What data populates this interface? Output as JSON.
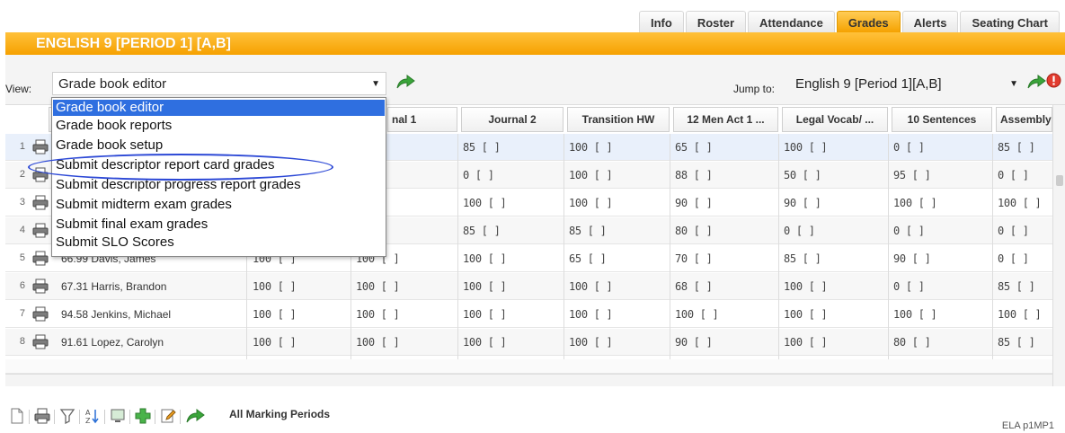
{
  "tabs": [
    {
      "label": "Info",
      "active": false
    },
    {
      "label": "Roster",
      "active": false
    },
    {
      "label": "Attendance",
      "active": false
    },
    {
      "label": "Grades",
      "active": true
    },
    {
      "label": "Alerts",
      "active": false
    },
    {
      "label": "Seating Chart",
      "active": false
    }
  ],
  "title": "ENGLISH 9 [PERIOD 1] [A,B]",
  "view": {
    "label": "View:",
    "value": "Grade book editor"
  },
  "jump": {
    "label": "Jump to:",
    "value": "English 9 [Period 1][A,B]"
  },
  "columns": [
    "nal 1",
    "Journal 2",
    "Transition HW",
    "12 Men Act 1 ...",
    "Legal Vocab/ ...",
    "10 Sentences",
    "Assembly"
  ],
  "rows": [
    {
      "n": "1",
      "score": "",
      "name": "",
      "cells": [
        "[ ]",
        "[ ]",
        "85 [ ]",
        "100 [ ]",
        "65 [ ]",
        "100 [ ]",
        "0 [ ]",
        "85 [ ]"
      ]
    },
    {
      "n": "2",
      "score": "",
      "name": "",
      "cells": [
        "",
        "[ ]",
        "0 [ ]",
        "100 [ ]",
        "88 [ ]",
        "50 [ ]",
        "95 [ ]",
        "0 [ ]"
      ]
    },
    {
      "n": "3",
      "score": "",
      "name": "",
      "cells": [
        "",
        "[ ]",
        "100 [ ]",
        "100 [ ]",
        "90 [ ]",
        "90 [ ]",
        "100 [ ]",
        "100 [ ]"
      ]
    },
    {
      "n": "4",
      "score": "",
      "name": "",
      "cells": [
        "",
        "[ ]",
        "85 [ ]",
        "85 [ ]",
        "80 [ ]",
        "0 [ ]",
        "0 [ ]",
        "0 [ ]"
      ]
    },
    {
      "n": "5",
      "score": "66.99",
      "name": "Davis, James",
      "cells": [
        "100 [ ]",
        "100 [ ]",
        "100 [ ]",
        "65 [ ]",
        "70 [ ]",
        "85 [ ]",
        "90 [ ]",
        "0 [ ]"
      ]
    },
    {
      "n": "6",
      "score": "67.31",
      "name": "Harris, Brandon",
      "cells": [
        "100 [ ]",
        "100 [ ]",
        "100 [ ]",
        "100 [ ]",
        "68 [ ]",
        "100 [ ]",
        "0 [ ]",
        "85 [ ]"
      ]
    },
    {
      "n": "7",
      "score": "94.58",
      "name": "Jenkins, Michael",
      "cells": [
        "100 [ ]",
        "100 [ ]",
        "100 [ ]",
        "100 [ ]",
        "100 [ ]",
        "100 [ ]",
        "100 [ ]",
        "100 [ ]"
      ]
    },
    {
      "n": "8",
      "score": "91.61",
      "name": "Lopez, Carolyn",
      "cells": [
        "100 [ ]",
        "100 [ ]",
        "100 [ ]",
        "100 [ ]",
        "90 [ ]",
        "100 [ ]",
        "80 [ ]",
        "85 [ ]"
      ]
    }
  ],
  "dropdown": [
    "Grade book editor",
    "Grade book reports",
    "Grade book setup",
    "Submit descriptor report card grades",
    "Submit descriptor progress report grades",
    "Submit midterm exam grades",
    "Submit final exam grades",
    "Submit SLO Scores"
  ],
  "footer": {
    "marking_periods": "All Marking Periods",
    "code": "ELA p1MP1"
  },
  "colors": {
    "accent": "#f6a100",
    "highlight": "#2f6fe0",
    "circle": "#2d49d6",
    "go_arrow": "#3aa53a"
  }
}
